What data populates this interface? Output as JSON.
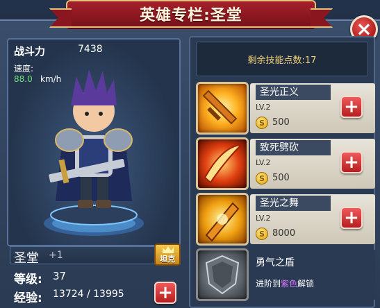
{
  "title": "英雄专栏:圣堂",
  "close_icon": "close-icon",
  "hero": {
    "power_label": "战斗力",
    "power_value": "7438",
    "speed_label": "速度:",
    "speed_value": "88.0",
    "speed_unit": "km/h",
    "name": "圣堂",
    "plus": "+1",
    "class_label": "坦克",
    "level_label": "等级:",
    "level_value": "37",
    "exp_label": "经验:",
    "exp_value": "13724 / 13995",
    "exp_ratio": 0.9806
  },
  "skills": {
    "points_text": "剩余技能点数:17",
    "items": [
      {
        "name": "圣光正义",
        "level": "LV.2",
        "cost": "500",
        "icon": "holy-sword-icon"
      },
      {
        "name": "致死劈砍",
        "level": "LV.2",
        "cost": "500",
        "icon": "fatal-slash-icon"
      },
      {
        "name": "圣光之舞",
        "level": "LV.2",
        "cost": "8000",
        "icon": "holy-dance-icon"
      }
    ],
    "locked": {
      "name": "勇气之盾",
      "unlock_prefix": "进阶到",
      "unlock_color": "紫色",
      "unlock_suffix": "解锁",
      "icon": "shield-icon"
    }
  },
  "coin_symbol": "S",
  "plus_symbol": "+",
  "colors": {
    "accent_red": "#b21d1d",
    "gold": "#f2d27a",
    "purple": "#d879ff",
    "speed_green": "#6fe07a"
  }
}
